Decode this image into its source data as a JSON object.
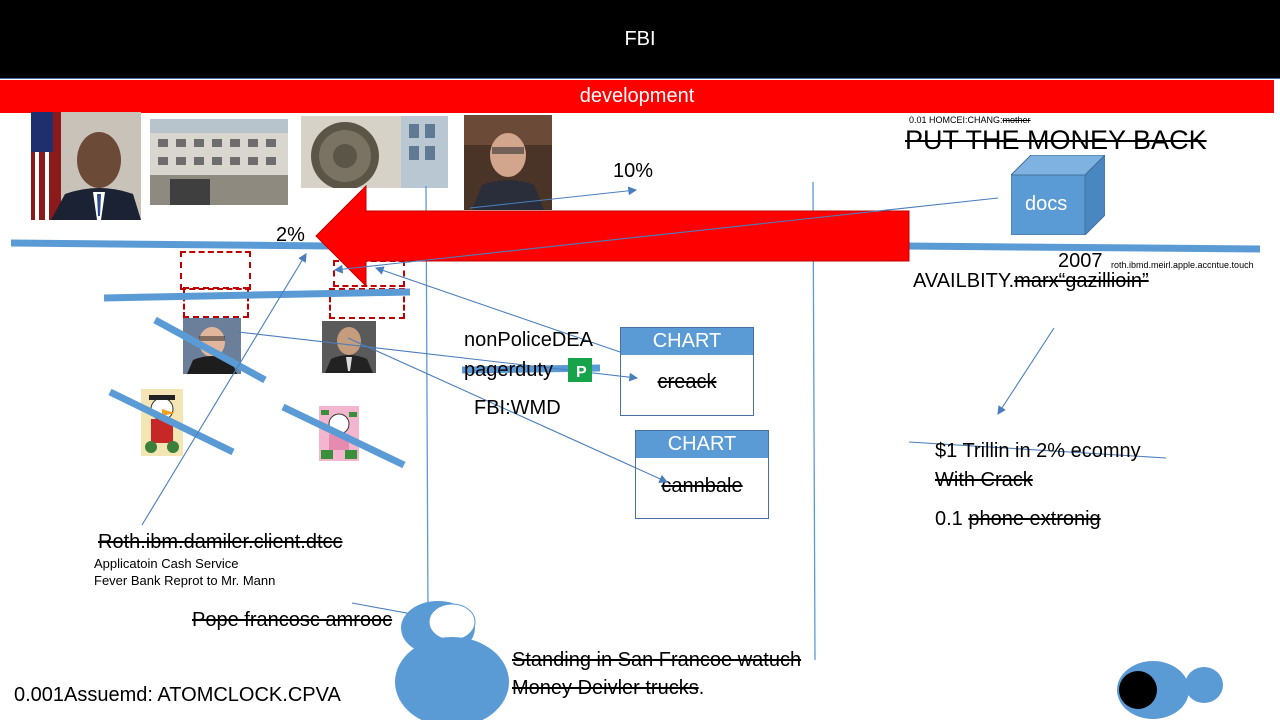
{
  "header": {
    "title": "FBI"
  },
  "banner": {
    "label": "development"
  },
  "labels": {
    "pct_10": "10%",
    "pct_2": "2%",
    "small_top": "0.01 HOMCEI:CHANG:",
    "small_top_struck": "mother",
    "put_money": "PUT THE MONEY BACK",
    "docs": "docs",
    "year": "2007",
    "roth_small": "roth.ibmd.meirl.apple.accntue.touch",
    "availbity": "AVAILBITY.",
    "availbity_struck": "marx“gazillioin”",
    "non_police": "nonPoliceDEA",
    "pagerduty": "pagerduty",
    "fbi_wmd": "FBI:WMD",
    "trillion_1": "$1 Trillin in 2% ecomny",
    "trillion_2": "With Crack",
    "phone_prefix": "0.1 ",
    "phone_struck": "phone extronig",
    "roth_client": "Roth.ibm.damiler.client.dtcc",
    "cash_service": "Applicatoin Cash Service",
    "fever_bank": "Fever Bank Reprot to Mr. Mann",
    "pope": "Pope francosc amrooc",
    "standing_1": "Standing in San Francoe watuch",
    "standing_2": "Money Deivler trucks",
    "standing_dot": ".",
    "atom": "0.001Assuemd: ATOMCLOCK.CPVA"
  },
  "charts": [
    {
      "head": "CHART",
      "body": "creack"
    },
    {
      "head": "CHART",
      "body": "cannbale"
    }
  ],
  "colors": {
    "accent_blue": "#5b9bd5",
    "line_blue": "#4a7ebb",
    "arrow_red": "#ff0000",
    "dash_red": "#c00000",
    "pager_green": "#16a34a"
  }
}
